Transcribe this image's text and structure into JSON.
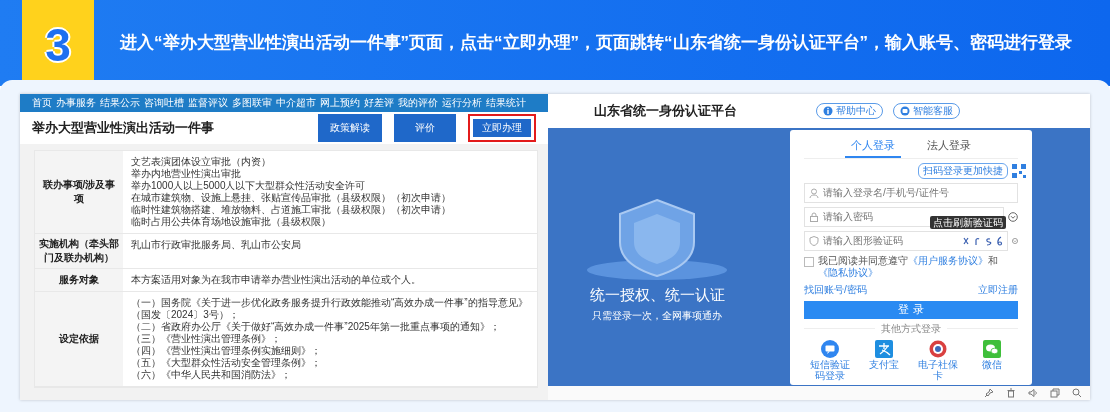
{
  "step": {
    "number": "3",
    "instruction": "进入“举办大型营业性演出活动一件事”页面，点击“立即办理”，页面跳转“山东省统一身份认证平台”，输入账号、密码进行登录"
  },
  "left_page": {
    "nav": [
      "首页",
      "办事服务",
      "结果公示",
      "咨询吐槽",
      "监督评议",
      "多图联审",
      "中介超市",
      "网上预约",
      "好差评",
      "我的评价",
      "运行分析",
      "结果统计"
    ],
    "title": "举办大型营业性演出活动一件事",
    "buttons": [
      {
        "label": "政策解读",
        "highlighted": false
      },
      {
        "label": "评价",
        "highlighted": false
      },
      {
        "label": "立即办理",
        "highlighted": true
      }
    ],
    "rows": [
      {
        "label": "联办事项/涉及事项",
        "lines": [
          "文艺表演团体设立审批（内资）",
          "举办内地营业性演出审批",
          "举办1000人以上5000人以下大型群众性活动安全许可",
          "在城市建筑物、设施上悬挂、张贴宣传品审批（县级权限）（初次申请）",
          "临时性建筑物搭建、堆放物料、占道施工审批（县级权限）（初次申请）",
          "临时占用公共体育场地设施审批（县级权限）"
        ]
      },
      {
        "label": "实施机构（牵头部门及联办机构）",
        "lines": [
          "乳山市行政审批服务局、乳山市公安局"
        ]
      },
      {
        "label": "服务对象",
        "lines": [
          "本方案适用对象为在我市申请举办营业性演出活动的单位或个人。"
        ]
      },
      {
        "label": "设定依据",
        "lines": [
          "（一）国务院《关于进一步优化政务服务提升行政效能推动“高效办成一件事”的指导意见》（国发〔2024〕3号）；",
          "（二）省政府办公厅《关于做好“高效办成一件事”2025年第一批重点事项的通知》；",
          "（三）《营业性演出管理条例》；",
          "（四）《营业性演出管理条例实施细则》；",
          "（五）《大型群众性活动安全管理条例》；",
          "（六）《中华人民共和国消防法》；"
        ]
      }
    ]
  },
  "right_page": {
    "title": "山东省统一身份认证平台",
    "header_links": [
      {
        "kind": "help",
        "label": "帮助中心"
      },
      {
        "kind": "service",
        "label": "智能客服"
      }
    ],
    "slogan": "统一授权、统一认证",
    "subslogan": "只需登录一次，全网事项通办",
    "tabs": [
      {
        "label": "个人登录",
        "selected": true
      },
      {
        "label": "法人登录",
        "selected": false
      }
    ],
    "qr_hint": "扫码登录更加快捷",
    "fields": [
      {
        "kind": "user",
        "placeholder": "请输入登录名/手机号/证件号"
      },
      {
        "kind": "password",
        "placeholder": "请输入密码"
      },
      {
        "kind": "captcha",
        "placeholder": "请输入图形验证码"
      }
    ],
    "captcha_tooltip": "点击刷新验证码",
    "agreement": {
      "checked": false,
      "text": "我已阅读并同意遵守",
      "links": [
        "《用户服务协议》",
        "《隐私协议》"
      ],
      "joiner": "和"
    },
    "forgot_link": "找回账号/密码",
    "register_link": "立即注册",
    "login_button": "登 录",
    "other_methods_title": "其他方式登录",
    "other_methods": [
      {
        "kind": "sms",
        "label": "短信验证码登录"
      },
      {
        "kind": "alipay",
        "label": "支付宝"
      },
      {
        "kind": "social-card",
        "label": "电子社保卡"
      },
      {
        "kind": "wechat",
        "label": "微信"
      }
    ]
  }
}
